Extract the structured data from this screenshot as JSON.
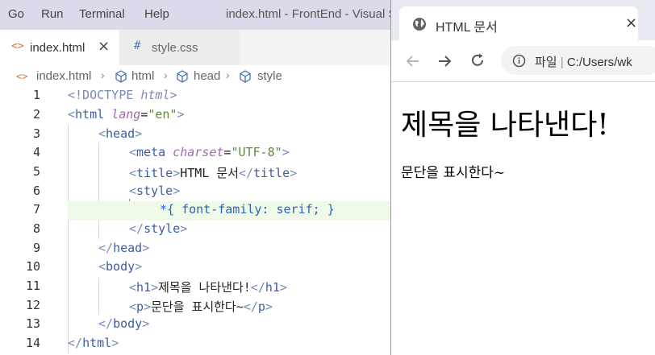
{
  "editor": {
    "menu": [
      "Go",
      "Run",
      "Terminal",
      "Help"
    ],
    "window_title": "index.html - FrontEnd - Visual S",
    "tabs": [
      {
        "label": "index.html",
        "icon": "<>",
        "close": "×"
      },
      {
        "label": "style.css",
        "icon": "#"
      }
    ],
    "breadcrumb": [
      "index.html",
      "html",
      "head",
      "style"
    ],
    "line_numbers": [
      "1",
      "2",
      "3",
      "4",
      "5",
      "6",
      "7",
      "8",
      "9",
      "10",
      "11",
      "12",
      "13",
      "14"
    ],
    "lines": {
      "l1a": "<!DOCTYPE ",
      "l1b": "html",
      "l1c": ">",
      "l2a": "<",
      "l2b": "html",
      "l2c": " lang",
      "l2d": "=",
      "l2e": "\"en\"",
      "l2f": ">",
      "l3a": "<",
      "l3b": "head",
      "l3c": ">",
      "l4a": "<",
      "l4b": "meta",
      "l4c": " charset",
      "l4d": "=",
      "l4e": "\"UTF-8\"",
      "l4f": ">",
      "l5a": "<",
      "l5b": "title",
      "l5c": ">",
      "l5d": "HTML 문서",
      "l5e": "</",
      "l5f": "title",
      "l5g": ">",
      "l6a": "<",
      "l6b": "style",
      "l6c": ">",
      "l7": "*{ font-family: serif; }",
      "l8a": "</",
      "l8b": "style",
      "l8c": ">",
      "l9a": "</",
      "l9b": "head",
      "l9c": ">",
      "l10a": "<",
      "l10b": "body",
      "l10c": ">",
      "l11a": "<",
      "l11b": "h1",
      "l11c": ">",
      "l11d": "제목을 나타낸다!",
      "l11e": "</",
      "l11f": "h1",
      "l11g": ">",
      "l12a": "<",
      "l12b": "p",
      "l12c": ">",
      "l12d": "문단을 표시한다~",
      "l12e": "</",
      "l12f": "p",
      "l12g": ">",
      "l13a": "</",
      "l13b": "body",
      "l13c": ">",
      "l14a": "</",
      "l14b": "html",
      "l14c": ">"
    }
  },
  "browser": {
    "tab_title": "HTML 문서",
    "tab_close": "×",
    "address_label": "파일",
    "address_path": "C:/Users/wk",
    "page_h1": "제목을 나타낸다!",
    "page_p": "문단을 표시한다~"
  },
  "icons": {
    "globe": "globe-icon",
    "back": "arrow-left-icon",
    "forward": "arrow-right-icon",
    "reload": "reload-icon",
    "info": "info-icon",
    "html_file": "html-file-icon",
    "css_file": "css-file-icon",
    "symbol": "symbol-cube-icon"
  },
  "colors": {
    "menubar": "#ddd9ea",
    "tag": "#7a8ab5",
    "tagname": "#3b5ca3",
    "attr": "#a06ab0",
    "string": "#5d8a3a",
    "highlight": "#eef9e8"
  }
}
